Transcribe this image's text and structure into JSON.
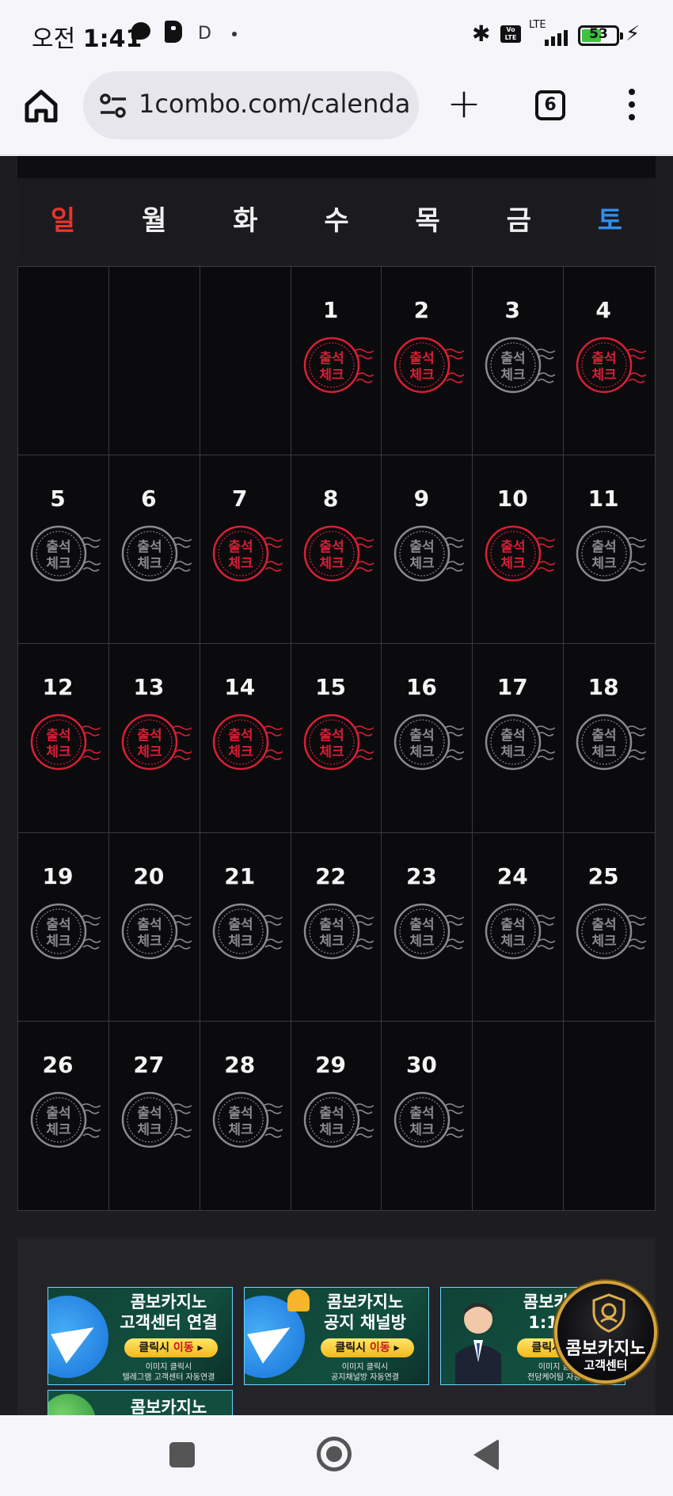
{
  "status_bar": {
    "time_prefix": "오전",
    "time": "1:41",
    "d_label": "D",
    "volte_label": "Vo LTE",
    "lte_label": "LTE",
    "battery": "53"
  },
  "browser": {
    "url": "1combo.com/calenda",
    "tab_count": "6"
  },
  "calendar": {
    "weekdays": [
      {
        "label": "일",
        "color": "#e8352c"
      },
      {
        "label": "월",
        "color": "#f0f0f0"
      },
      {
        "label": "화",
        "color": "#f0f0f0"
      },
      {
        "label": "수",
        "color": "#f0f0f0"
      },
      {
        "label": "목",
        "color": "#f0f0f0"
      },
      {
        "label": "금",
        "color": "#f0f0f0"
      },
      {
        "label": "토",
        "color": "#2f8ff0"
      }
    ],
    "stamp_text": [
      "출석",
      "체크"
    ],
    "stamp_colors": {
      "checked": "#d91f35",
      "unchecked": "#8a8a8e"
    },
    "weeks": [
      [
        {
          "day": ""
        },
        {
          "day": ""
        },
        {
          "day": ""
        },
        {
          "day": "1",
          "checked": true
        },
        {
          "day": "2",
          "checked": true
        },
        {
          "day": "3",
          "checked": false
        },
        {
          "day": "4",
          "checked": true
        }
      ],
      [
        {
          "day": "5",
          "checked": false
        },
        {
          "day": "6",
          "checked": false
        },
        {
          "day": "7",
          "checked": true
        },
        {
          "day": "8",
          "checked": true
        },
        {
          "day": "9",
          "checked": false
        },
        {
          "day": "10",
          "checked": true
        },
        {
          "day": "11",
          "checked": false
        }
      ],
      [
        {
          "day": "12",
          "checked": true
        },
        {
          "day": "13",
          "checked": true
        },
        {
          "day": "14",
          "checked": true
        },
        {
          "day": "15",
          "checked": true
        },
        {
          "day": "16",
          "checked": false
        },
        {
          "day": "17",
          "checked": false
        },
        {
          "day": "18",
          "checked": false
        }
      ],
      [
        {
          "day": "19",
          "checked": false
        },
        {
          "day": "20",
          "checked": false
        },
        {
          "day": "21",
          "checked": false
        },
        {
          "day": "22",
          "checked": false
        },
        {
          "day": "23",
          "checked": false
        },
        {
          "day": "24",
          "checked": false
        },
        {
          "day": "25",
          "checked": false
        }
      ],
      [
        {
          "day": "26",
          "checked": false
        },
        {
          "day": "27",
          "checked": false
        },
        {
          "day": "28",
          "checked": false
        },
        {
          "day": "29",
          "checked": false
        },
        {
          "day": "30",
          "checked": false
        },
        {
          "day": ""
        },
        {
          "day": ""
        }
      ]
    ]
  },
  "banners": [
    {
      "line1": "콤보카지노",
      "line2": "고객센터 연결",
      "button_prefix": "클릭시 ",
      "button_action": "이동",
      "button_suffix": " ▸",
      "sub1": "이미지 클릭시",
      "sub2": "텔레그램 고객센터 자동연결",
      "icon": "telegram-plane-icon"
    },
    {
      "line1": "콤보카지노",
      "line2": "공지 채널방",
      "button_prefix": "클릭시 ",
      "button_action": "이동",
      "button_suffix": " ▸",
      "sub1": "이미지 클릭시",
      "sub2": "공지채널방 자동연결",
      "icon": "bell-icon"
    },
    {
      "line1": "콤보카지노",
      "line2": "1:1 전담",
      "button_prefix": "클릭시 ",
      "button_action": "이동",
      "button_suffix": " ▸",
      "sub1": "이미지 클릭시",
      "sub2": "전담케어팀 자동연결",
      "icon": "agent-avatar-icon"
    }
  ],
  "banner_partial": {
    "line1": "콤보카지노"
  },
  "fab": {
    "line1": "콤보카지노",
    "line2": "고객센터"
  }
}
